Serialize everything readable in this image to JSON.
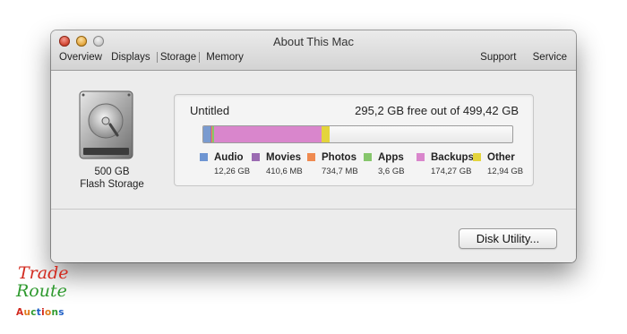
{
  "window": {
    "title": "About This Mac",
    "tabs_left": [
      "Overview",
      "Displays",
      "Storage",
      "Memory"
    ],
    "active_tab": "Storage",
    "tabs_right": [
      "Support",
      "Service"
    ]
  },
  "disk": {
    "capacity": "500 GB",
    "type": "Flash Storage"
  },
  "volume": {
    "name": "Untitled",
    "free_text": "295,2 GB free out of 499,42 GB"
  },
  "storage_bar": [
    {
      "name": "Audio",
      "fraction": 0.0245,
      "color": "#7a9bd0"
    },
    {
      "name": "Movies",
      "fraction": 0.0008,
      "color": "#9b6bb2"
    },
    {
      "name": "Photos",
      "fraction": 0.0015,
      "color": "#ef8a50"
    },
    {
      "name": "Apps",
      "fraction": 0.0072,
      "color": "#86c66c"
    },
    {
      "name": "Backups",
      "fraction": 0.349,
      "color": "#d986cc"
    },
    {
      "name": "Other",
      "fraction": 0.0259,
      "color": "#e4d43c"
    }
  ],
  "legend": [
    {
      "label": "Audio",
      "size": "12,26 GB",
      "color": "#6e95d2"
    },
    {
      "label": "Movies",
      "size": "410,6 MB",
      "color": "#9b6bb2"
    },
    {
      "label": "Photos",
      "size": "734,7 MB",
      "color": "#ef8a50"
    },
    {
      "label": "Apps",
      "size": "3,6 GB",
      "color": "#86c66c"
    },
    {
      "label": "Backups",
      "size": "174,27 GB",
      "color": "#d986cc"
    },
    {
      "label": "Other",
      "size": "12,94 GB",
      "color": "#e4d43c"
    }
  ],
  "buttons": {
    "disk_utility": "Disk Utility..."
  },
  "watermark": {
    "line1": "Trade",
    "line2": "Route",
    "line3": "Auctions"
  }
}
